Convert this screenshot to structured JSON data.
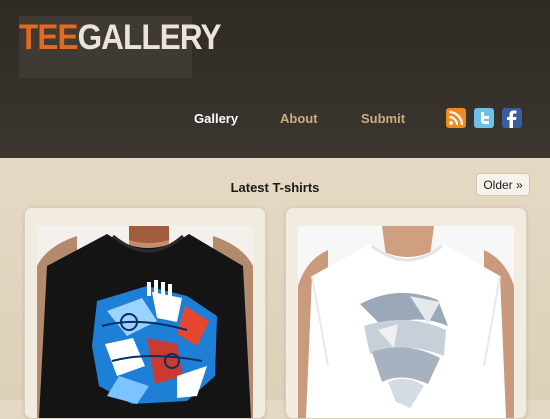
{
  "logo": {
    "part1": "TEE",
    "part2": "GALLERY"
  },
  "nav": [
    {
      "label": "Gallery",
      "active": true
    },
    {
      "label": "About",
      "active": false
    },
    {
      "label": "Submit",
      "active": false
    }
  ],
  "social": [
    "rss-icon",
    "twitter-icon",
    "facebook-icon"
  ],
  "main": {
    "title": "Latest T-shirts",
    "older_label": "Older »"
  },
  "colors": {
    "header_bg": "#2e2a24",
    "accent_orange": "#e66a1e",
    "nav_gold": "#c9ad83",
    "page_bg": "#e4d8c2"
  }
}
